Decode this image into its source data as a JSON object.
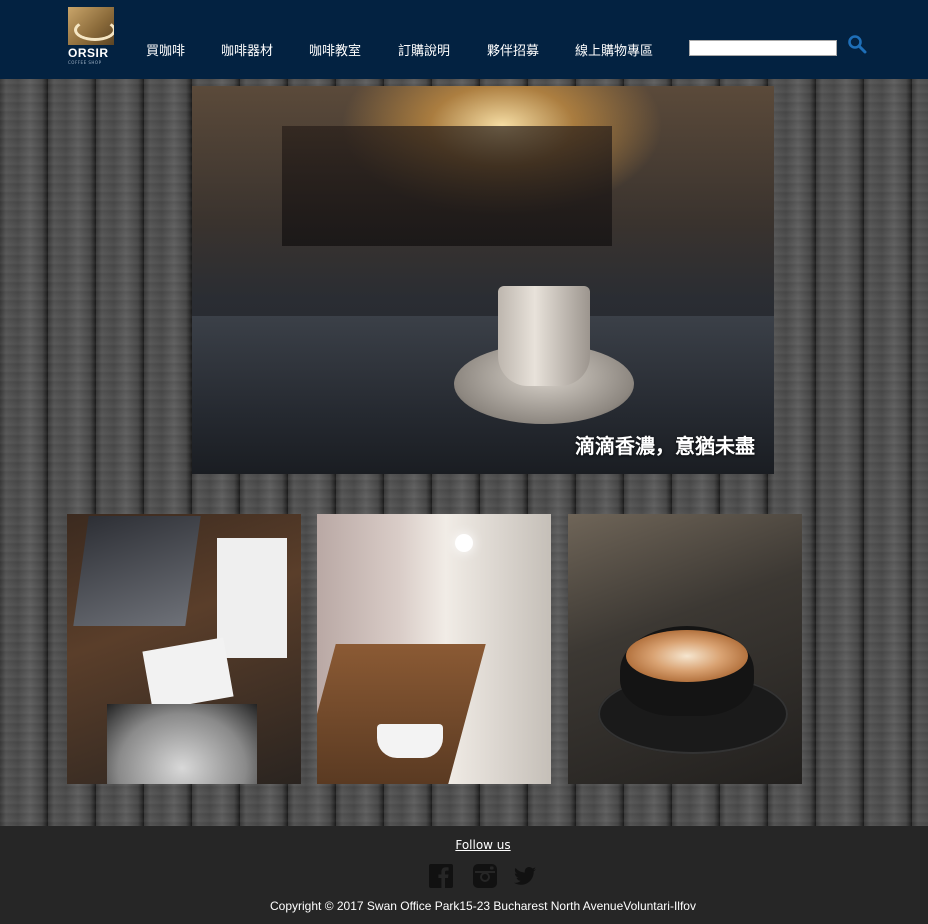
{
  "brand": {
    "name": "ORSIR",
    "tagline": "COFFEE SHOP"
  },
  "nav": {
    "items": [
      {
        "label": "買咖啡"
      },
      {
        "label": "咖啡器材"
      },
      {
        "label": "咖啡教室"
      },
      {
        "label": "訂購說明"
      },
      {
        "label": "夥伴招募"
      },
      {
        "label": "線上購物專區"
      }
    ]
  },
  "search": {
    "value": "",
    "icon": "search-icon"
  },
  "hero": {
    "caption": "滴滴香濃，意猶未盡"
  },
  "gallery": {
    "items": [
      {
        "name": "laptop-coffee-desk"
      },
      {
        "name": "coffee-bar-window"
      },
      {
        "name": "latte-art-cup"
      }
    ]
  },
  "footer": {
    "follow_label": "Follow us",
    "social_icons": [
      "facebook-icon",
      "instagram-icon",
      "twitter-icon"
    ],
    "copyright": "Copyright © 2017 Swan Office Park15-23 Bucharest North AvenueVoluntari-Ilfov"
  },
  "colors": {
    "header_bg": "#032241",
    "footer_bg": "#262626",
    "accent": "#1e6fb8"
  }
}
